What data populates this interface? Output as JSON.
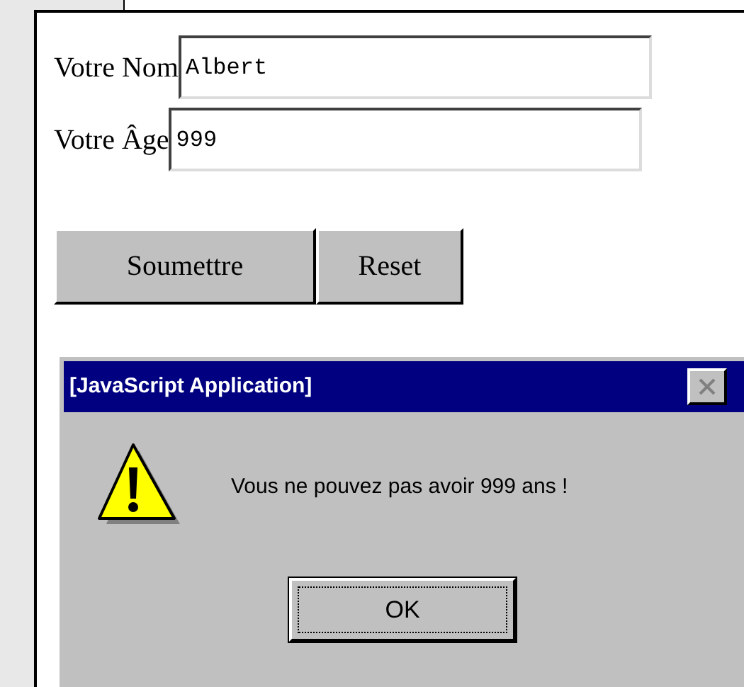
{
  "form": {
    "fields": [
      {
        "label": "Votre Nom",
        "value": "Albert"
      },
      {
        "label": "Votre Âge",
        "value": "999"
      }
    ],
    "buttons": [
      "Soumettre",
      "Reset"
    ]
  },
  "dialog": {
    "title": "[JavaScript Application]",
    "message": "Vous ne pouvez pas avoir 999 ans !",
    "buttons": [
      {
        "label": "OK",
        "focused": true
      }
    ]
  }
}
